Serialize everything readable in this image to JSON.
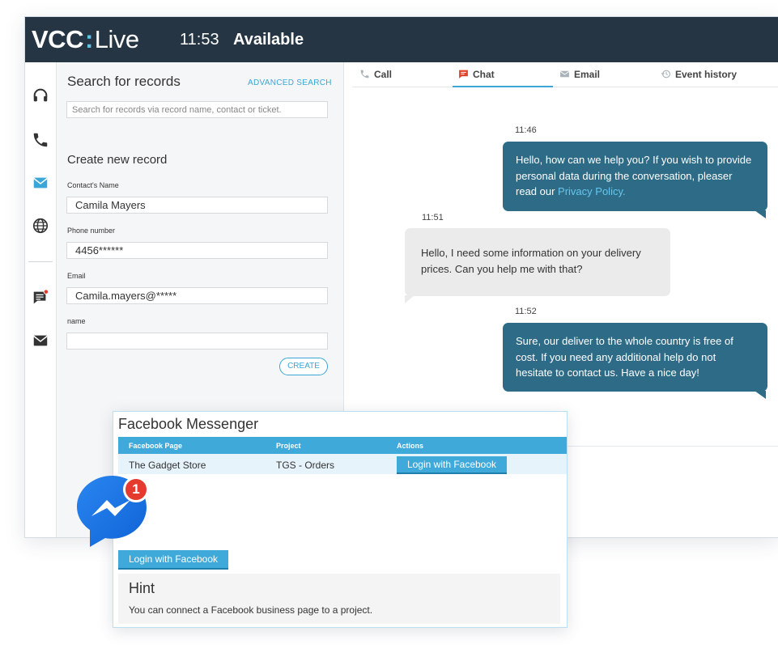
{
  "brand": {
    "name_bold": "VCC",
    "separator": ":",
    "name_light": "Live"
  },
  "header": {
    "time": "11:53",
    "status": "Available"
  },
  "iconbar": {
    "items": [
      "headset-icon",
      "phone-icon",
      "email-icon",
      "globe-icon",
      "chat-notification-icon",
      "envelope-icon"
    ],
    "accent": "#3aa7d6"
  },
  "search": {
    "title": "Search for records",
    "advanced_label": "ADVANCED SEARCH",
    "placeholder": "Search for records via record name, contact or ticket."
  },
  "create": {
    "title": "Create new record",
    "fields": [
      {
        "label": "Contact's Name",
        "value": "Camila Mayers"
      },
      {
        "label": "Phone number",
        "value": "4456******"
      },
      {
        "label": "Email",
        "value": "Camila.mayers@*****"
      },
      {
        "label": "name",
        "value": ""
      }
    ],
    "button_label": "CREATE"
  },
  "tabs": [
    {
      "label": "Call",
      "icon": "phone-icon"
    },
    {
      "label": "Chat",
      "icon": "chat-icon",
      "active": true
    },
    {
      "label": "Email",
      "icon": "envelope-icon"
    },
    {
      "label": "Event history",
      "icon": "history-icon"
    }
  ],
  "messages": [
    {
      "time": "11:46",
      "from": "agent",
      "text": "Hello, how can we help you? If you wish to provide personal data during the conversation, pleaser read our ",
      "link": "Privacy Policy."
    },
    {
      "time": "11:51",
      "from": "customer",
      "text": "Hello, I need some information on your delivery prices. Can you help me with that?"
    },
    {
      "time": "11:52",
      "from": "agent",
      "text": "Sure, our deliver to the whole country is free of cost. If you need any additional help do not hesitate to contact us. Have a nice day!"
    }
  ],
  "facebook": {
    "title": "Facebook Messenger",
    "columns": [
      "Facebook Page",
      "Project",
      "Actions"
    ],
    "rows": [
      {
        "page": "The Gadget Store",
        "project": "TGS - Orders",
        "action": "Login with Facebook"
      }
    ],
    "login_button": "Login with Facebook",
    "hint_title": "Hint",
    "hint_text": "You can connect a Facebook business page to a project."
  },
  "notification": {
    "count": "1"
  },
  "colors": {
    "topbar": "#253544",
    "agent_bubble": "#2d6b86",
    "customer_bubble": "#ebebeb",
    "link": "#66c6ee",
    "facebook_blue": "#3fa9d9",
    "badge_red": "#e43b2e"
  }
}
